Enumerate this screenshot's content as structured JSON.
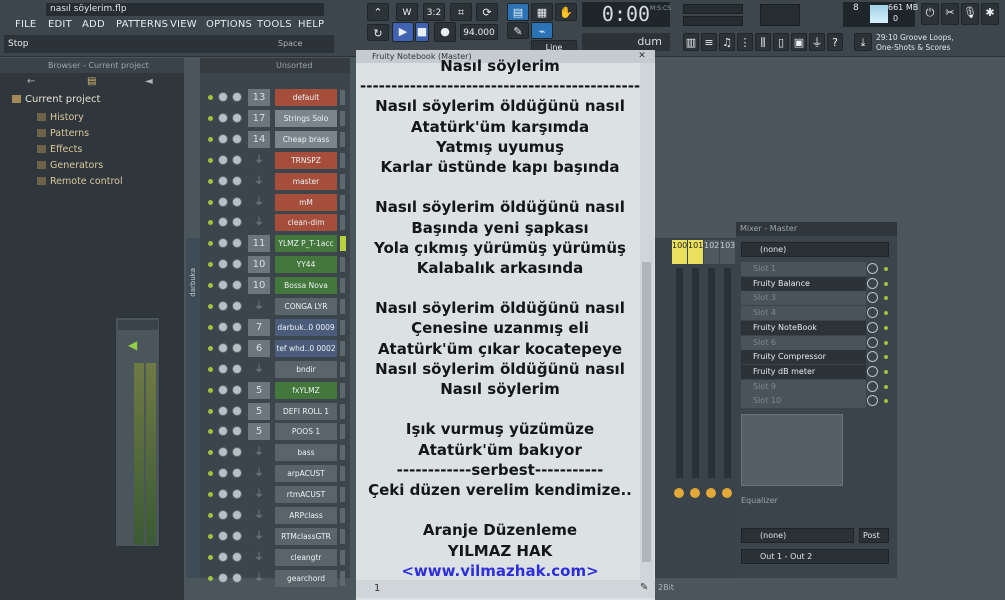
{
  "title_bar": {
    "file": "nasıl söylerim.flp",
    "hint": "Stop",
    "space_label": "Space"
  },
  "menu": [
    "FILE",
    "EDIT",
    "ADD",
    "PATTERNS",
    "VIEW",
    "OPTIONS",
    "TOOLS",
    "HELP"
  ],
  "transport": {
    "time": "0:00",
    "time_unit": "M:S:CS",
    "tempo": "94.000",
    "beats": "3:2",
    "snap": "Line",
    "pattern": "dum"
  },
  "cpu": {
    "value": "8",
    "memory": "661 MB",
    "polyphony": "0"
  },
  "news": {
    "line1": "29:10  Groove Loops,",
    "line2": "One-Shots & Scores"
  },
  "browser": {
    "header": "Browser - Current project",
    "root": "Current project",
    "items": [
      "History",
      "Patterns",
      "Effects",
      "Generators",
      "Remote control"
    ]
  },
  "rack": {
    "header": "Unsorted",
    "side_label": "darbuka",
    "channels": [
      {
        "num": "13",
        "name": "default",
        "color": "#a44e3b"
      },
      {
        "num": "17",
        "name": "Strings Solo",
        "color": "#7a858c"
      },
      {
        "num": "14",
        "name": "Cheap brass",
        "color": "#7a858c"
      },
      {
        "num": "",
        "name": "TRNSPZ",
        "color": "#a44e3b"
      },
      {
        "num": "",
        "name": "master",
        "color": "#a44e3b"
      },
      {
        "num": "",
        "name": "mM",
        "color": "#a44e3b"
      },
      {
        "num": "",
        "name": "clean-dim",
        "color": "#a44e3b"
      },
      {
        "num": "11",
        "name": "YLMZ P_T-1acc",
        "color": "#43773c"
      },
      {
        "num": "10",
        "name": "YY44",
        "color": "#43773c"
      },
      {
        "num": "10",
        "name": "Bossa Nova",
        "color": "#43773c"
      },
      {
        "num": "",
        "name": "CONGA LYR",
        "color": "#5a646b"
      },
      {
        "num": "7",
        "name": "darbuk..0 0009",
        "color": "#4a5c7a"
      },
      {
        "num": "6",
        "name": "tef whd..0 0002",
        "color": "#4a5c7a"
      },
      {
        "num": "",
        "name": "bndir",
        "color": "#5a646b"
      },
      {
        "num": "5",
        "name": "fxYLMZ",
        "color": "#43773c"
      },
      {
        "num": "5",
        "name": "DEFI ROLL 1",
        "color": "#5a646b"
      },
      {
        "num": "5",
        "name": "POOS 1",
        "color": "#5a646b"
      },
      {
        "num": "",
        "name": "bass",
        "color": "#5a646b"
      },
      {
        "num": "",
        "name": "arpACUST",
        "color": "#5a646b"
      },
      {
        "num": "",
        "name": "rtmACUST",
        "color": "#5a646b"
      },
      {
        "num": "",
        "name": "ARPclass",
        "color": "#5a646b"
      },
      {
        "num": "",
        "name": "RTMclassGTR",
        "color": "#5a646b"
      },
      {
        "num": "",
        "name": "cleangtr",
        "color": "#5a646b"
      },
      {
        "num": "",
        "name": "gearchord",
        "color": "#5a646b"
      }
    ]
  },
  "notebook": {
    "title": "Fruity Notebook (Master)",
    "page": "1",
    "lines": [
      "Nasıl söylerim",
      "-----------------------------------------------",
      "Nasıl söylerim öldüğünü nasıl",
      "Atatürk'üm karşımda",
      "Yatmış uyumuş",
      "Karlar üstünde kapı başında",
      "",
      "Nasıl söylerim öldüğünü nasıl",
      "Başında yeni şapkası",
      "Yola çıkmış yürümüş yürümüş",
      "Kalabalık arkasında",
      "",
      "Nasıl söylerim öldüğünü nasıl",
      "Çenesine uzanmış eli",
      "Atatürk'üm çıkar kocatepeye",
      "Nasıl söylerim öldüğünü nasıl",
      "Nasıl söylerim",
      "",
      "Işık vurmuş yüzümüze",
      "Atatürk'üm bakıyor",
      "------------serbest-----------",
      "Çeki düzen verelim kendimize..",
      "",
      "Aranje Düzenleme",
      "YILMAZ HAK",
      "<www.yilmazhak.com>"
    ]
  },
  "mixer": {
    "title": "Mixer - Master",
    "preset": "(none)",
    "tracks": [
      "100",
      "101",
      "102",
      "103"
    ],
    "slots": [
      "Slot 1",
      "Fruity Balance",
      "Slot 3",
      "Slot 4",
      "Fruity NoteBook",
      "Slot 6",
      "Fruity Compressor",
      "Fruity dB meter",
      "Slot 9",
      "Slot 10"
    ],
    "eq_label": "Equalizer",
    "post_preset": "(none)",
    "post": "Post",
    "output": "Out 1 - Out 2",
    "bit": "2Bit"
  }
}
